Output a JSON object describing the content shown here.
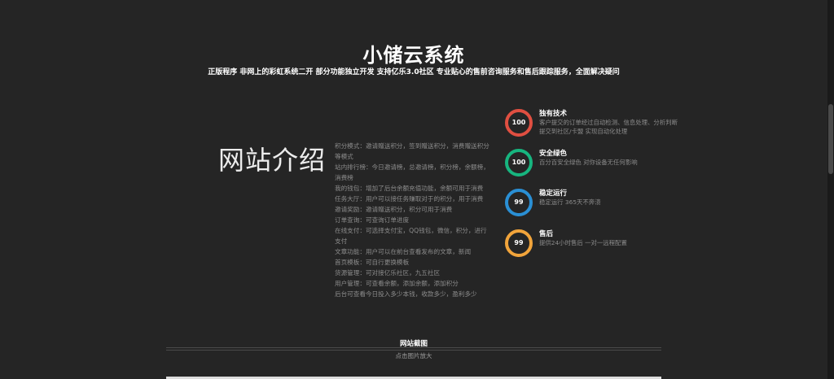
{
  "hero": {
    "title": "小储云系统",
    "subtitle": "正版程序 非网上的彩虹系统二开 部分功能独立开发 支持亿乐3.0社区 专业贴心的售前咨询服务和售后跟踪服务，全面解决疑问"
  },
  "intro": {
    "heading": "网站介绍",
    "features": [
      "积分模式：邀请赠送积分，签到赠送积分，消费赠送积分等模式",
      "站内排行榜：今日邀请榜，总邀请榜，积分榜，余额榜，消费榜",
      "我的钱包：增加了后台余额充值功能，余额可用于消费",
      "任务大厅：用户可以接任务赚取对于的积分，用于消费",
      "邀请奖励：邀请赠送积分，积分可用于消费",
      "订单查询：可查询订单进度",
      "在线支付：可选择支付宝，QQ钱包，微信，积分，进行支付",
      "文章功能：用户可以在前台查看发布的文章，新闻",
      "首页模板：可自行更换模板",
      "货源管理：可对接亿乐社区，九五社区",
      "用户管理：可查看余额，添加余额，添加积分",
      "后台可查看今日投入多少本钱，收款多少，盈利多少"
    ]
  },
  "stats": [
    {
      "value": "100",
      "title": "独有技术",
      "desc": "客户提交的订单经过自动检测、信息处理、分析判断 提交到社区/卡盟 实现自动化处理",
      "color": "#e04f41"
    },
    {
      "value": "100",
      "title": "安全绿色",
      "desc": "百分百安全绿色 对你设备无任何影响",
      "color": "#17b57f"
    },
    {
      "value": "99",
      "title": "稳定运行",
      "desc": "稳定运行 365天不奔溃",
      "color": "#2a8fd4"
    },
    {
      "value": "99",
      "title": "售后",
      "desc": "提供24小时售后 一对一远程配置",
      "color": "#f1a43b"
    }
  ],
  "screenshots": {
    "title": "网站截图",
    "caption": "点击图片放大"
  }
}
